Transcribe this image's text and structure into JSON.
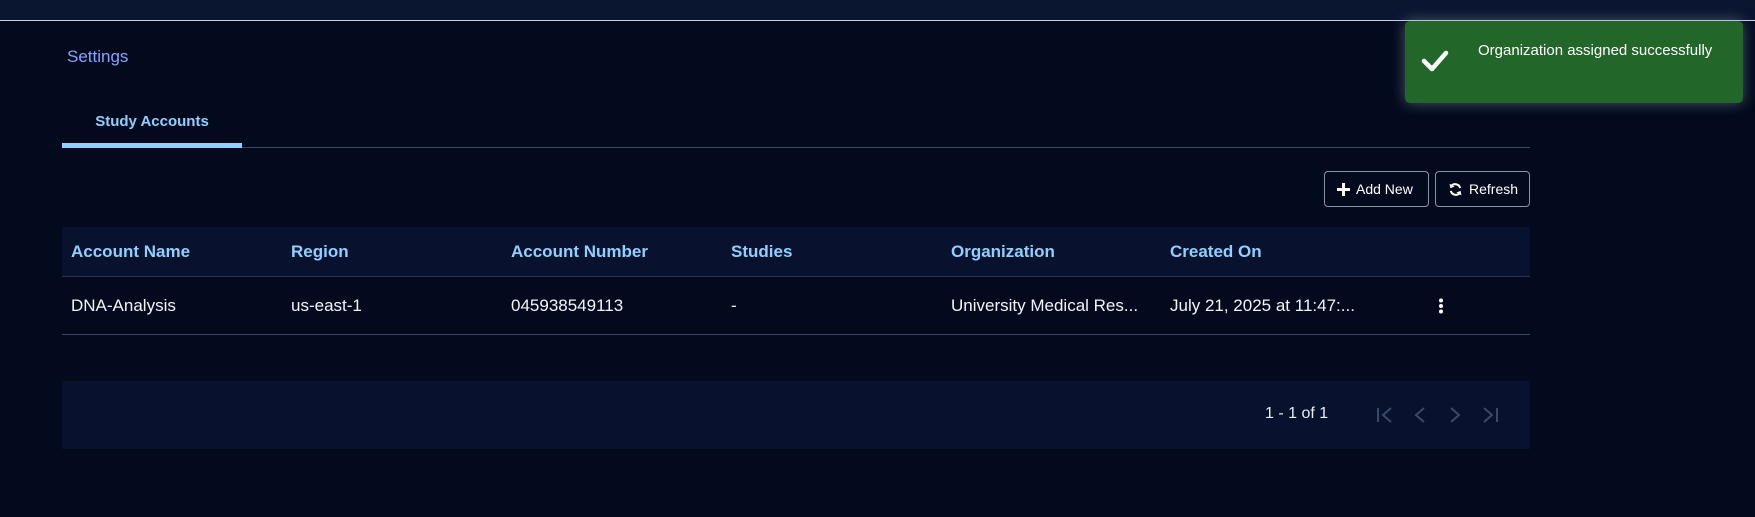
{
  "breadcrumb": {
    "label": "Settings"
  },
  "tabs": [
    {
      "label": "Study Accounts",
      "active": true
    }
  ],
  "toolbar": {
    "add_label": "Add New",
    "refresh_label": "Refresh"
  },
  "table": {
    "columns": [
      "Account Name",
      "Region",
      "Account Number",
      "Studies",
      "Organization",
      "Created On"
    ],
    "rows": [
      {
        "account_name": "DNA-Analysis",
        "region": "us-east-1",
        "account_number": "045938549113",
        "studies": "-",
        "organization": "University Medical Res...",
        "created_on": "July 21, 2025 at 11:47:..."
      }
    ]
  },
  "pagination": {
    "range_text": "1 - 1 of 1"
  },
  "toast": {
    "message": "Organization assigned successfully",
    "type": "success"
  },
  "icons": {
    "add": "plus-icon",
    "refresh": "refresh-icon",
    "row_menu": "more-vertical-icon",
    "toast": "check-icon",
    "first": "first-page-icon",
    "prev": "chevron-left-icon",
    "next": "chevron-right-icon",
    "last": "last-page-icon"
  },
  "colors": {
    "background": "#030a1d",
    "accent": "#8fd0ff",
    "link": "#8aa2ff",
    "table_header_bg": "#08122e",
    "toast_bg": "#22662a"
  }
}
